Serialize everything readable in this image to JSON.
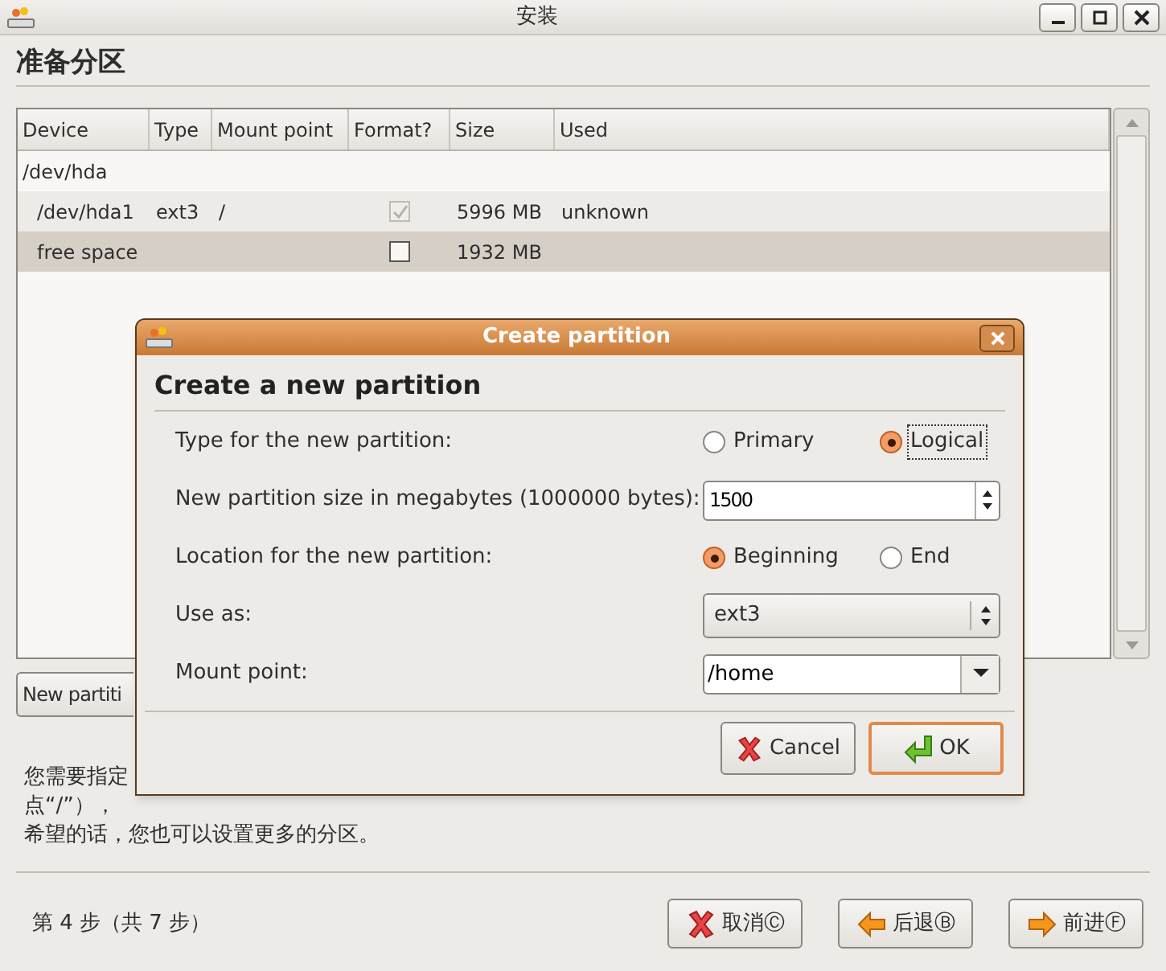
{
  "window": {
    "title": "安装"
  },
  "page_title": "准备分区",
  "table": {
    "columns": [
      "Device",
      "Type",
      "Mount point",
      "Format?",
      "Size",
      "Used"
    ],
    "rows": [
      {
        "device": "/dev/hda",
        "selected": false,
        "children": [
          {
            "device": "/dev/hda1",
            "type": "ext3",
            "mount_point": "/",
            "format": {
              "checked": true,
              "disabled": true
            },
            "size": "5996 MB",
            "used": "unknown",
            "selected": false
          },
          {
            "device": "free space",
            "format": {
              "checked": false,
              "disabled": false
            },
            "size": "1932 MB",
            "selected": true
          }
        ]
      }
    ]
  },
  "new_partition_button": "New partiti",
  "description": [
    "您需要指定",
    "点“/”），",
    "希望的话，您也可以设置更多的分区。"
  ],
  "footer": {
    "step": "第 4 步（共 7 步）",
    "buttons": [
      {
        "label": "取消Ⓒ",
        "kind": "cancel"
      },
      {
        "label": "后退Ⓑ",
        "kind": "back"
      },
      {
        "label": "前进Ⓕ",
        "kind": "forward"
      }
    ]
  },
  "dialog": {
    "title": "Create partition",
    "heading": "Create a new partition",
    "fields": [
      {
        "kind": "radio",
        "label": "Type for the new partition:",
        "options": [
          {
            "label": "Primary",
            "selected": false,
            "focused": false
          },
          {
            "label": "Logical",
            "selected": true,
            "focused": true
          }
        ]
      },
      {
        "kind": "spin",
        "label": "New partition size in megabytes (1000000 bytes):",
        "value": "1500"
      },
      {
        "kind": "radio",
        "label": "Location for the new partition:",
        "options": [
          {
            "label": "Beginning",
            "selected": true,
            "focused": false
          },
          {
            "label": "End",
            "selected": false,
            "focused": false
          }
        ]
      },
      {
        "kind": "combo",
        "label": "Use as:",
        "value": "ext3"
      },
      {
        "kind": "combo_entry",
        "label": "Mount point:",
        "value": "/home"
      }
    ],
    "buttons": [
      {
        "label": "Cancel",
        "kind": "cancel",
        "default": false
      },
      {
        "label": "OK",
        "kind": "ok",
        "default": true
      }
    ]
  }
}
